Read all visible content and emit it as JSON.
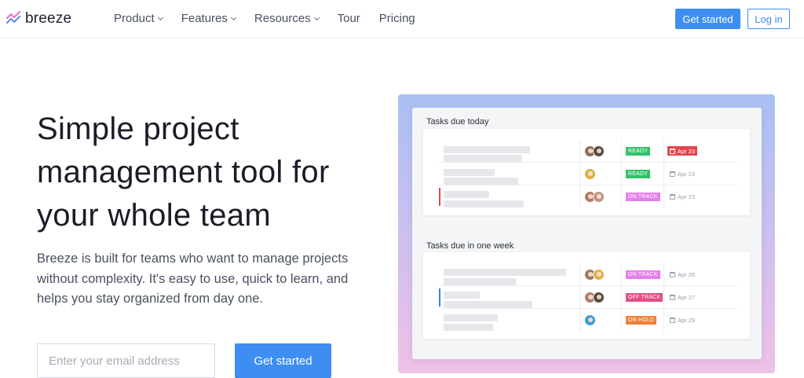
{
  "nav": {
    "logo_text": "breeze",
    "links": [
      {
        "label": "Product",
        "dropdown": true
      },
      {
        "label": "Features",
        "dropdown": true
      },
      {
        "label": "Resources",
        "dropdown": true
      },
      {
        "label": "Tour",
        "dropdown": false
      },
      {
        "label": "Pricing",
        "dropdown": false
      }
    ],
    "get_started_label": "Get started",
    "login_label": "Log in"
  },
  "hero": {
    "title_lines": [
      "Simple project",
      "management tool for",
      "your whole team"
    ],
    "description_lines": [
      "Breeze is built for teams who want to manage projects",
      "without complexity. It's easy to use, quick to learn, and",
      "helps you stay organized from day one."
    ],
    "email_placeholder": "Enter your email address",
    "cta_label": "Get started"
  },
  "preview": {
    "sections": [
      {
        "title": "Tasks due today",
        "tasks": [
          {
            "status": "READY",
            "status_color": "#33c26b",
            "date": "Apr 23",
            "overdue": true,
            "flag_color": "",
            "avatar_colors": [
              "#8a6d55",
              "#5b4a3e"
            ]
          },
          {
            "status": "READY",
            "status_color": "#33c26b",
            "date": "Apr 23",
            "overdue": false,
            "flag_color": "",
            "avatar_colors": [
              "#d8b340"
            ]
          },
          {
            "status": "ON TRACK",
            "status_color": "#e580e8",
            "date": "Apr 23",
            "overdue": false,
            "flag_color": "#e2454e",
            "avatar_colors": [
              "#b07b6b",
              "#c49384"
            ]
          }
        ]
      },
      {
        "title": "Tasks due in one week",
        "tasks": [
          {
            "status": "ON TRACK",
            "status_color": "#e580e8",
            "date": "Apr 26",
            "overdue": false,
            "flag_color": "",
            "avatar_colors": [
              "#9c7a60",
              "#e1b24a"
            ]
          },
          {
            "status": "OFF TRACK",
            "status_color": "#e24d86",
            "date": "Apr 27",
            "overdue": false,
            "flag_color": "#3d7fe0",
            "avatar_colors": [
              "#b07b6b",
              "#5b4a3e"
            ]
          },
          {
            "status": "ON HOLD",
            "status_color": "#f07f3a",
            "date": "Apr 29",
            "overdue": false,
            "flag_color": "",
            "avatar_colors": [
              "#3d9ad6"
            ]
          }
        ]
      }
    ]
  },
  "colors": {
    "accent": "#3d8ef0",
    "text_dark": "#1a1d28",
    "text_muted": "#4a5062"
  }
}
